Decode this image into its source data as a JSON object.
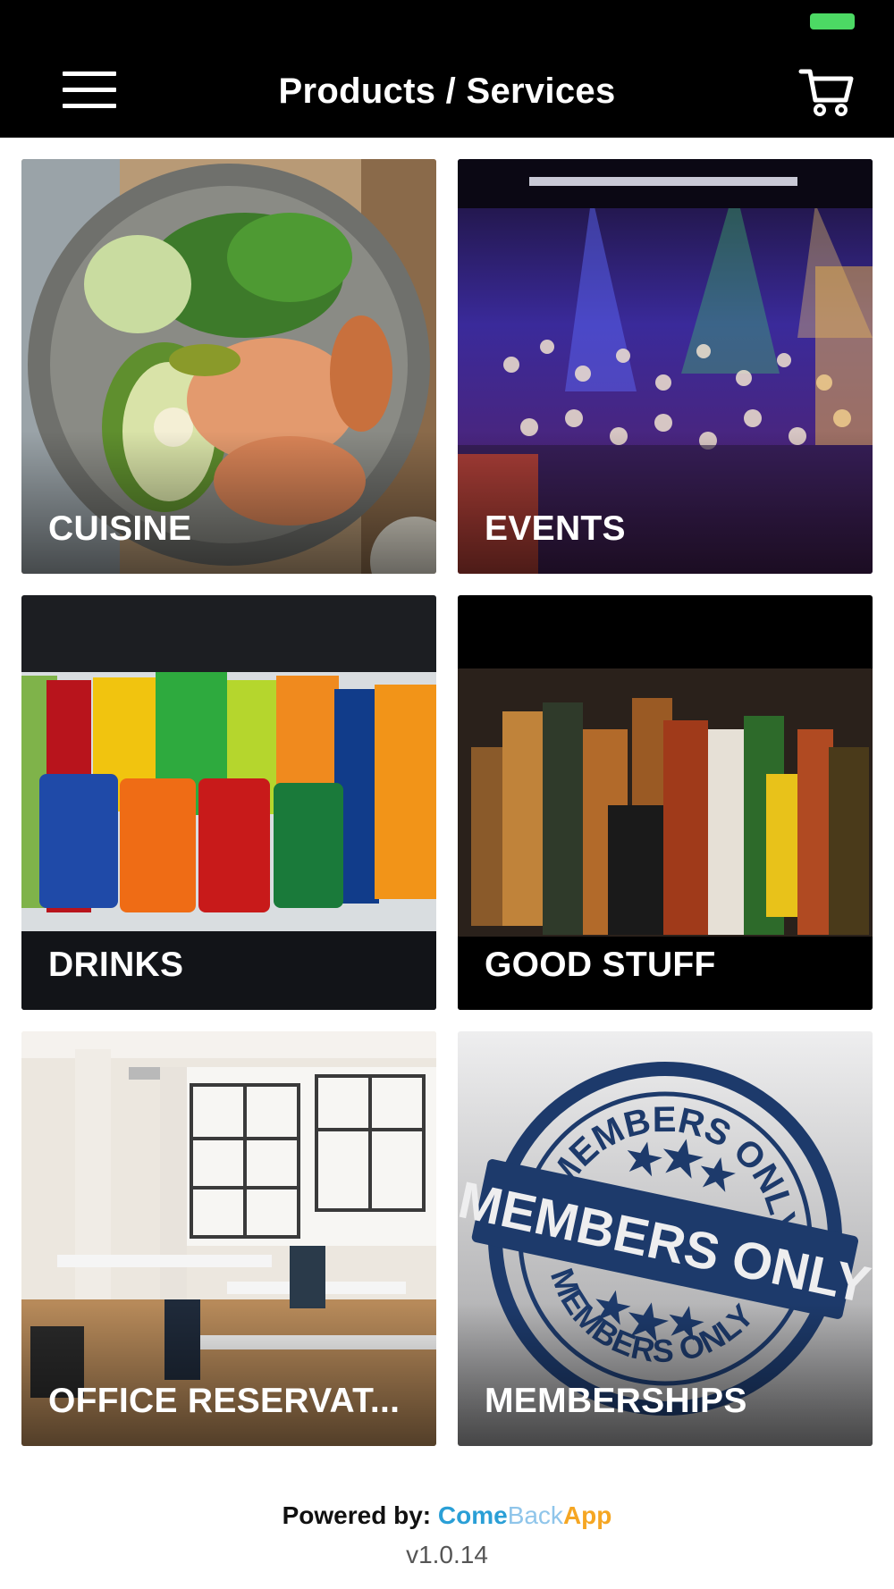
{
  "header": {
    "title": "Products / Services",
    "menu_icon": "hamburger-menu-icon",
    "cart_icon": "shopping-cart-icon"
  },
  "tiles": [
    {
      "label": "CUISINE",
      "image": "salad-bowl-with-shrimp-photo"
    },
    {
      "label": "EVENTS",
      "image": "nightclub-crowd-photo"
    },
    {
      "label": "DRINKS",
      "image": "soda-bottles-and-cans-photo"
    },
    {
      "label": "GOOD STUFF",
      "image": "liquor-bottles-photo"
    },
    {
      "label": "OFFICE RESERVAT...",
      "image": "open-office-space-photo"
    },
    {
      "label": "MEMBERSHIPS",
      "image": "members-only-stamp"
    }
  ],
  "members_stamp": {
    "ring_top": "MEMBERS ONLY",
    "banner": "MEMBERS ONLY",
    "ring_bottom": "MEMBERS ONLY"
  },
  "footer": {
    "powered_by_label": "Powered by:",
    "brand_part1": "Come",
    "brand_part2": "Back",
    "brand_part3": "App",
    "version": "v1.0.14"
  },
  "colors": {
    "header_bg": "#000000",
    "battery": "#4cd964",
    "brand_blue": "#2a9fd6",
    "brand_light_blue": "#8fc5ea",
    "brand_orange": "#f5a623",
    "stamp_navy": "#1d3a6b"
  }
}
